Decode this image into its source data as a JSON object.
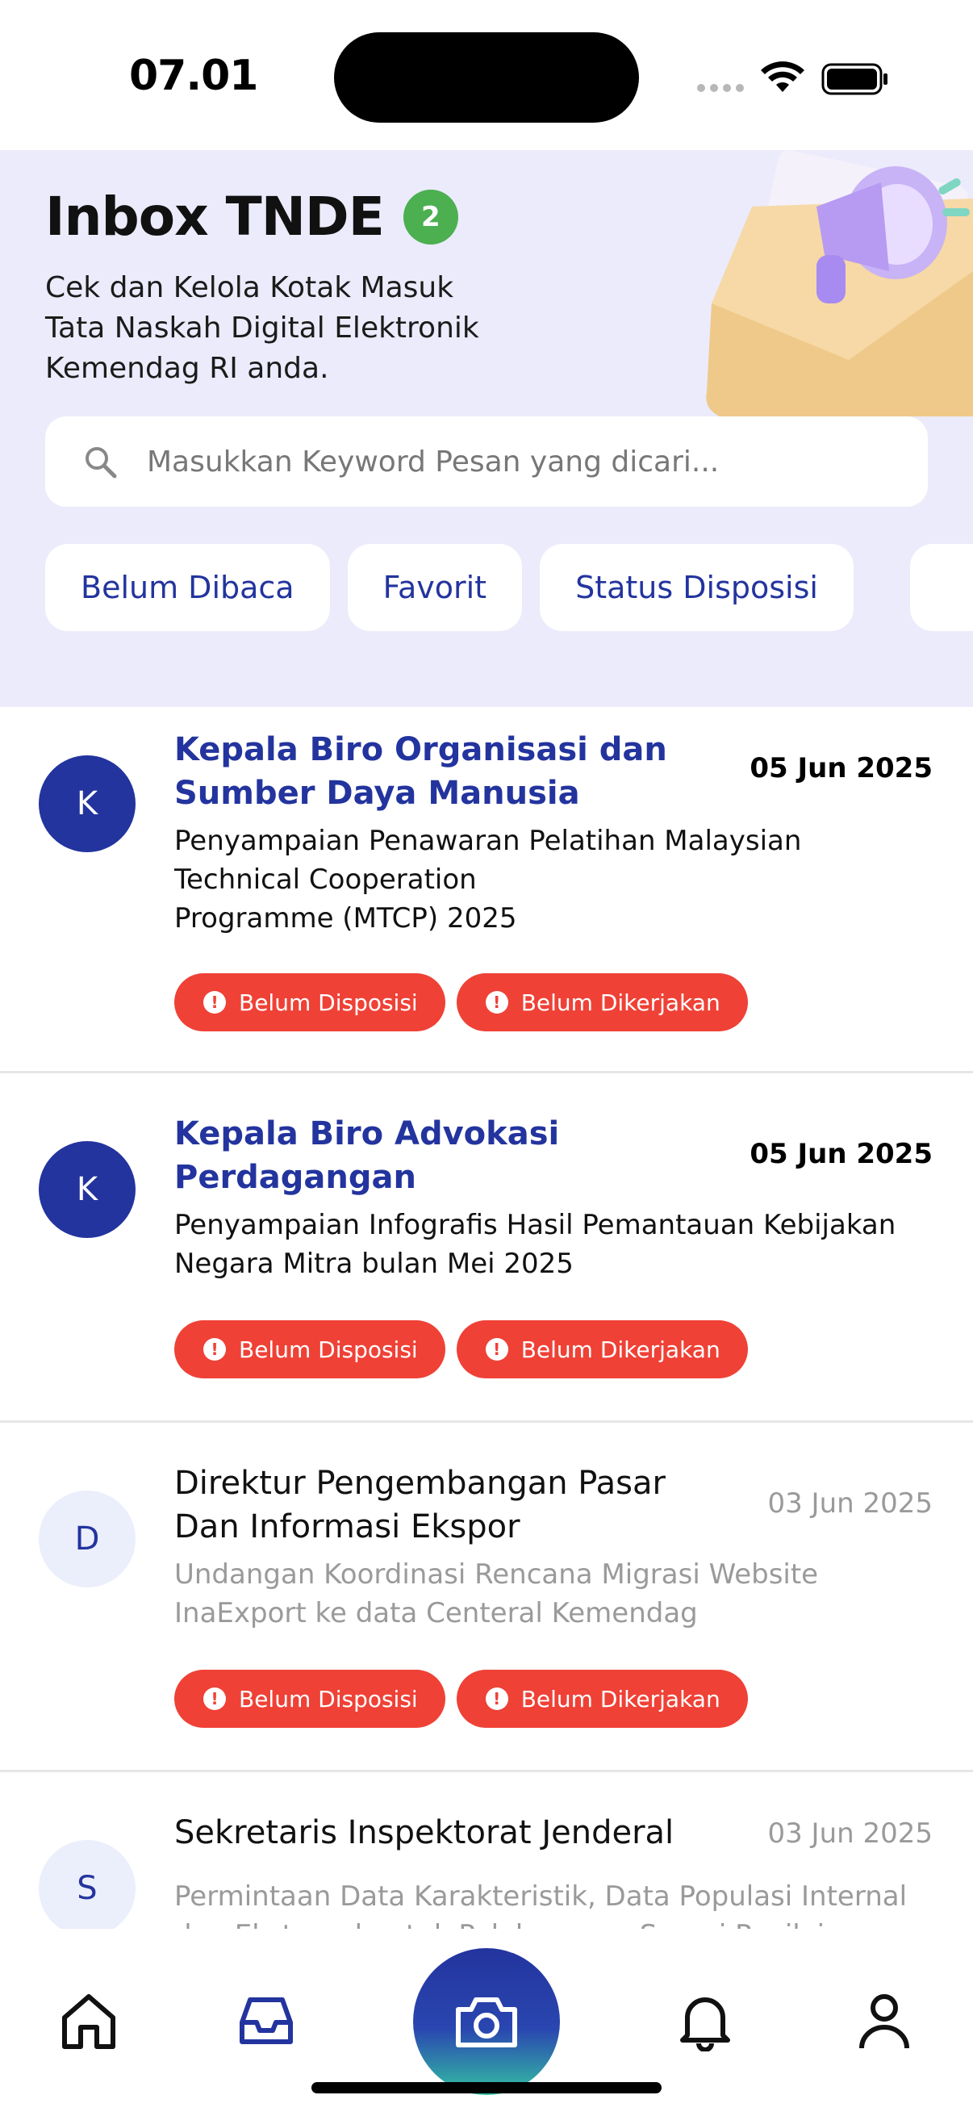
{
  "status_bar": {
    "time": "07.01"
  },
  "header": {
    "title": "Inbox TNDE",
    "unread_count": "2",
    "subtitle_lines": [
      "Cek dan Kelola Kotak Masuk",
      "Tata Naskah Digital Elektronik",
      "Kemendag RI anda."
    ]
  },
  "search": {
    "placeholder": "Masukkan Keyword Pesan yang dicari..."
  },
  "filters": [
    "Belum Dibaca",
    "Favorit",
    "Status Disposisi"
  ],
  "messages": [
    {
      "initial": "K",
      "sender": "Kepala Biro Organisasi dan Sumber Daya Manusia",
      "date": "05 Jun 2025",
      "subject_lines": [
        "Penyampaian Penawaran Pelatihan Malaysian",
        "Technical Cooperation",
        "Programme (MTCP) 2025"
      ],
      "tags": [
        "Belum Disposisi",
        "Belum Dikerjakan"
      ],
      "unread": true
    },
    {
      "initial": "K",
      "sender": "Kepala Biro Advokasi Perdagangan",
      "date": "05 Jun 2025",
      "subject_lines": [
        "Penyampaian Infografis Hasil Pemantauan Kebijakan",
        "Negara Mitra bulan Mei 2025"
      ],
      "tags": [
        "Belum Disposisi",
        "Belum Dikerjakan"
      ],
      "unread": true
    },
    {
      "initial": "D",
      "sender": "Direktur Pengembangan Pasar Dan Informasi Ekspor",
      "date": "03 Jun 2025",
      "subject_lines": [
        "Undangan Koordinasi Rencana Migrasi Website",
        "InaExport ke data Centeral Kemendag"
      ],
      "tags": [
        "Belum Disposisi",
        "Belum Dikerjakan"
      ],
      "unread": false
    },
    {
      "initial": "S",
      "sender": "Sekretaris Inspektorat Jenderal",
      "date": "03 Jun 2025",
      "subject_lines": [
        "Permintaan Data Karakteristik, Data Populasi Internal",
        "dan Eksternal untuk Pelaksanaan Survei Penilaian"
      ],
      "tags": [],
      "unread": false
    }
  ],
  "nav": {
    "items": [
      "home-icon",
      "inbox-icon",
      "camera-icon",
      "bell-icon",
      "profile-icon"
    ],
    "active": "inbox-icon"
  },
  "colors": {
    "primary": "#23349e",
    "header_bg": "#ebebfb",
    "tag_red": "#ef4136",
    "badge_green": "#4caf50"
  }
}
